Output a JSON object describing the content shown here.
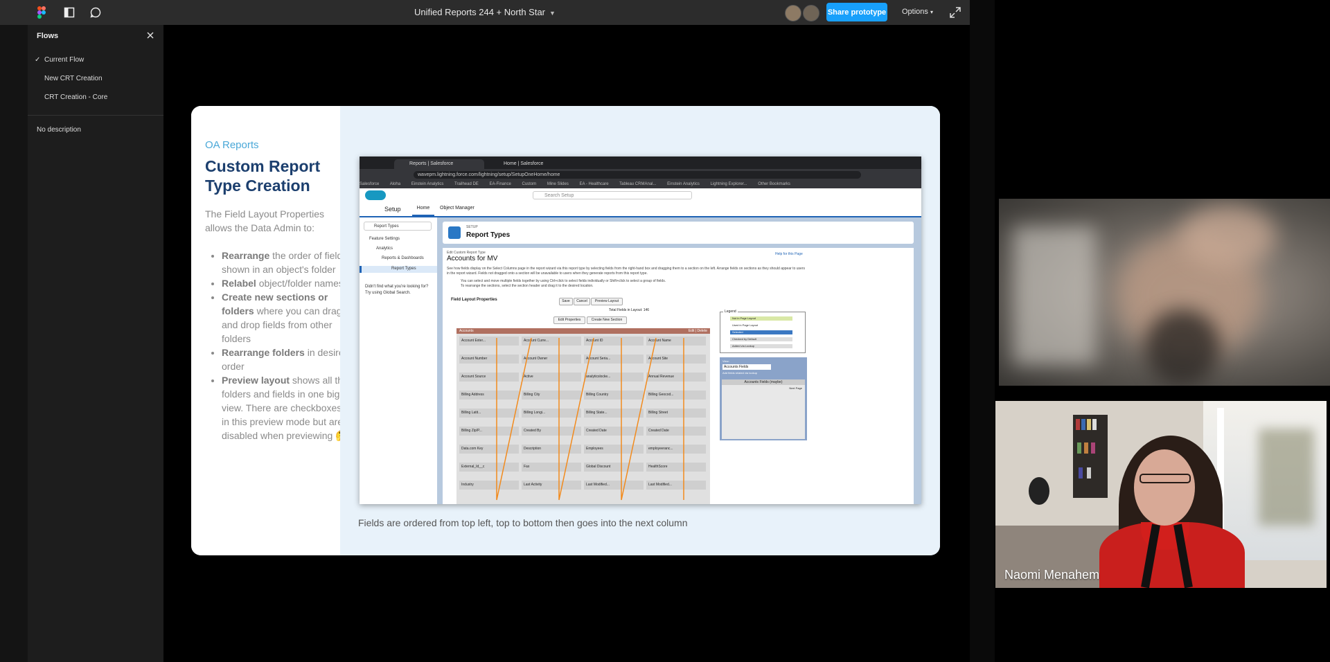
{
  "topbar": {
    "file_title": "Unified Reports 244 + North Star",
    "share_label": "Share prototype",
    "options_label": "Options"
  },
  "flows": {
    "header": "Flows",
    "items": [
      {
        "label": "Current Flow",
        "selected": true
      },
      {
        "label": "New CRT Creation",
        "selected": false
      },
      {
        "label": "CRT Creation - Core",
        "selected": false
      }
    ],
    "description": "No description"
  },
  "slide": {
    "kicker": "OA Reports",
    "title": "Custom Report Type Creation",
    "intro": "The Field Layout Properties allows the Data Admin to:",
    "bullets": [
      {
        "bold": "Rearrange",
        "rest": " the order of fields shown in an object's folder"
      },
      {
        "bold": "Relabel",
        "rest": " object/folder names"
      },
      {
        "bold": "Create new sections or folders",
        "rest": " where you can drag and drop fields from other folders"
      },
      {
        "bold": "Rearrange folders",
        "rest": " in desired order"
      },
      {
        "bold": "Preview layout",
        "rest": " shows all the folders and fields in one big view. There are checkboxes in this preview mode but are disabled when previewing 🤔"
      }
    ],
    "caption": "Fields are ordered from top left, top to bottom then goes into the next column"
  },
  "embedded_browser": {
    "tabs": [
      "Reports | Salesforce",
      "Home | Salesforce"
    ],
    "url": "wavepm.lightning.force.com/lightning/setup/SetupOneHome/home",
    "bookmarks": [
      "Salesforce",
      "Aloha",
      "Einstein Analytics",
      "Trailhead DE",
      "EA-Finance",
      "Custom",
      "Mine Slides",
      "EA - Healthcare",
      "Tableau CRMAnal...",
      "Einstein Analytics",
      "Lightning Explorer...",
      "Other Bookmarks"
    ],
    "sf_search": "Search Setup",
    "nav_setup": "Setup",
    "nav_home": "Home",
    "nav_object_manager": "Object Manager",
    "quick_find": "Report Types",
    "tree": [
      "Feature Settings",
      "Analytics",
      "Reports & Dashboards",
      "Report Types"
    ],
    "tree_hint": "Didn't find what you're looking for? Try using Global Search.",
    "page_setup": "SETUP",
    "page_title": "Report Types",
    "edit_label": "Edit Custom Report Type",
    "record_title": "Accounts for MV",
    "help_link": "Help for this Page",
    "para1": "See how fields display on the Select Columns page in the report wizard via this report type by selecting fields from the right-hand box and dragging them to a section on the left. Arrange fields on sections as they should appear to users in the report wizard. Fields not dragged onto a section will be unavailable to users when they generate reports from this report type.",
    "para2": "You can select and move multiple fields together by using Ctrl+click to select fields individually or Shift+click to select a group of fields.",
    "para3": "To rearrange the sections, select the section header and drag it to the desired location.",
    "flp_title": "Field Layout Properties",
    "btn_save": "Save",
    "btn_cancel": "Cancel",
    "btn_preview": "Preview Layout",
    "total_fields": "Total Fields in Layout: 146",
    "btn_edit_props": "Edit Properties",
    "btn_create_section": "Create New Section",
    "grid_header": "Accounts",
    "grid_header_right": "Edit | Delete",
    "grid_rows": [
      [
        "Account Exter...",
        "Account Curre...",
        "Account ID",
        "Account Name"
      ],
      [
        "Account Number",
        "Account Owner",
        "Account Seria...",
        "Account Site"
      ],
      [
        "Account Source",
        "Active",
        "analyticslocke...",
        "Annual Revenue"
      ],
      [
        "Billing Address",
        "Billing City",
        "Billing Country",
        "Billing Geocod..."
      ],
      [
        "Billing Latit...",
        "Billing Longi...",
        "Billing State...",
        "Billing Street"
      ],
      [
        "Billing Zip/P...",
        "Created By",
        "Created Date",
        "Created Date"
      ],
      [
        "Data.com Key",
        "Description",
        "Employees",
        "employeeranc..."
      ],
      [
        "External_Id__c",
        "Fax",
        "Global Discount",
        "HealthScore"
      ],
      [
        "Industry",
        "Last Activity",
        "Last Modified...",
        "Last Modified..."
      ]
    ],
    "legend_title": "Legend",
    "legend_items": [
      "Not in Page Layout",
      "Used in Page Layout",
      "Selected",
      "Checked by Default",
      "Added via Lookup"
    ],
    "view_label": "View:",
    "view_value": "Accounts Fields",
    "view_link": "Add fields related via lookup",
    "view_section": "Accounts Fields (maybe)",
    "view_next": "Next Page"
  },
  "video": {
    "participant_name": "Naomi Menahem"
  }
}
